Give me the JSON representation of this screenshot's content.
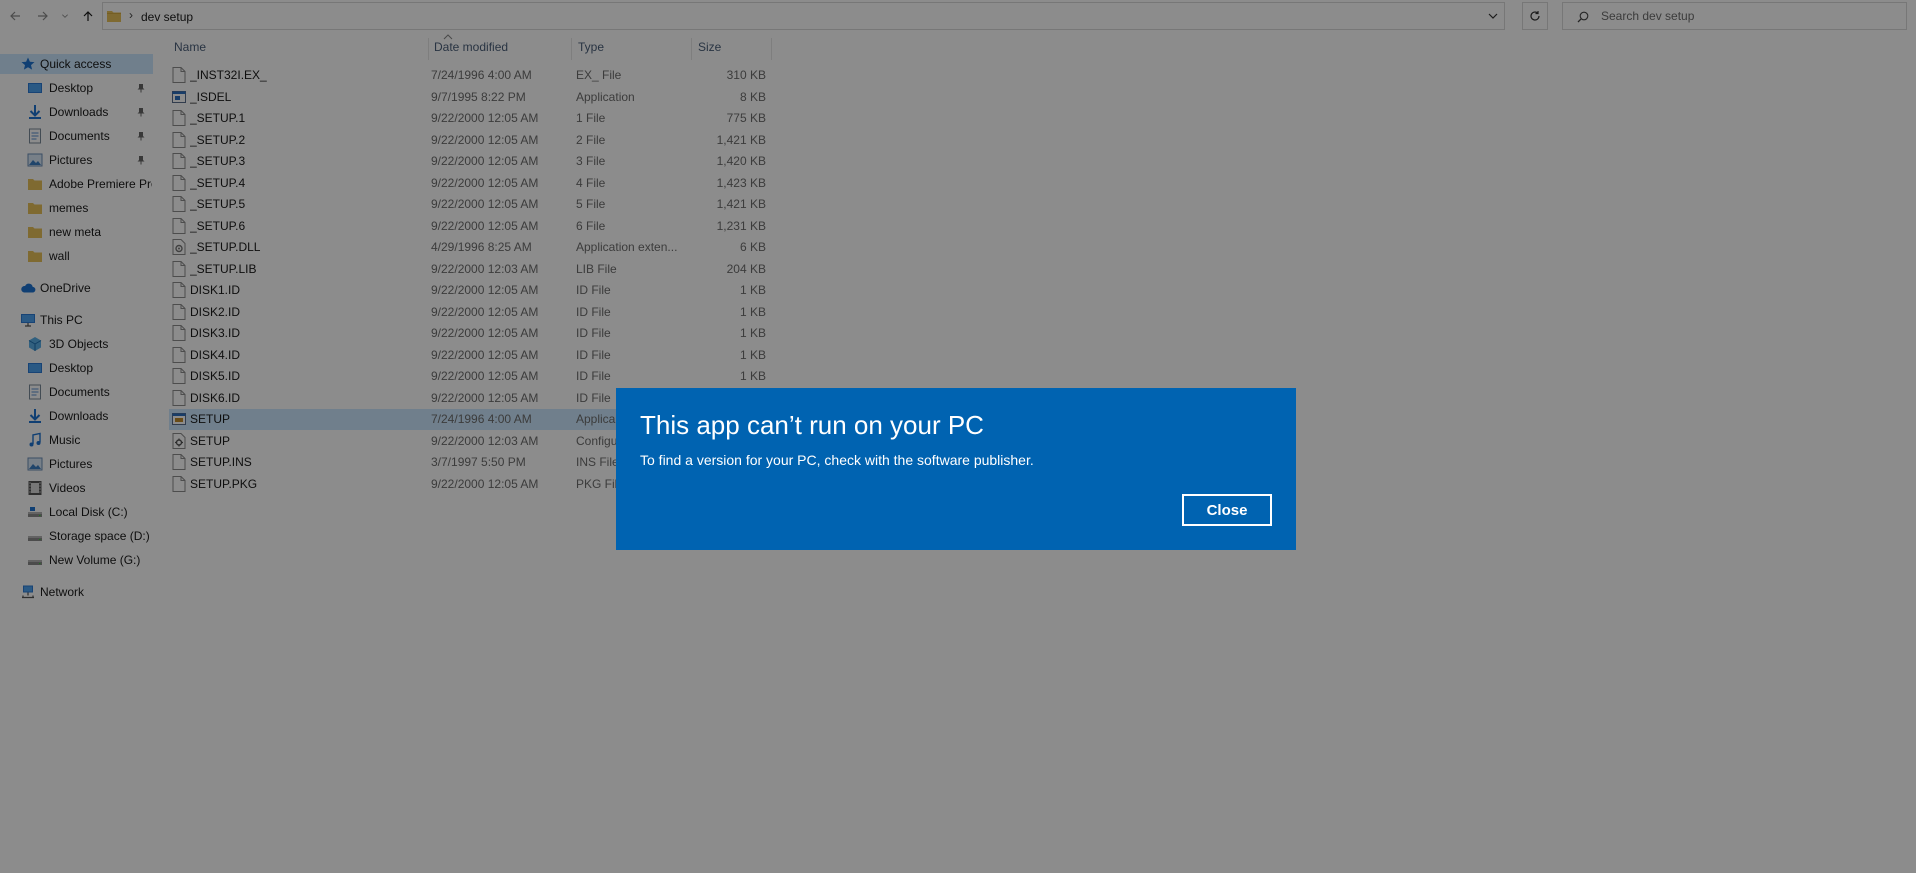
{
  "address_bar": {
    "path_segment": "dev setup",
    "separator": "›"
  },
  "search": {
    "placeholder": "Search dev setup"
  },
  "sidebar": {
    "quick_access": {
      "label": "Quick access",
      "items": [
        {
          "label": "Desktop",
          "icon": "desktop-icon",
          "pinned": true
        },
        {
          "label": "Downloads",
          "icon": "download-icon",
          "pinned": true
        },
        {
          "label": "Documents",
          "icon": "documents-icon",
          "pinned": true
        },
        {
          "label": "Pictures",
          "icon": "pictures-icon",
          "pinned": true
        },
        {
          "label": "Adobe Premiere Pro",
          "icon": "folder-icon",
          "pinned": false
        },
        {
          "label": "memes",
          "icon": "folder-icon",
          "pinned": false
        },
        {
          "label": "new meta",
          "icon": "folder-icon",
          "pinned": false
        },
        {
          "label": "wall",
          "icon": "folder-icon",
          "pinned": false
        }
      ]
    },
    "onedrive": {
      "label": "OneDrive"
    },
    "this_pc": {
      "label": "This PC",
      "items": [
        {
          "label": "3D Objects",
          "icon": "3d-objects-icon"
        },
        {
          "label": "Desktop",
          "icon": "desktop-icon"
        },
        {
          "label": "Documents",
          "icon": "documents-icon"
        },
        {
          "label": "Downloads",
          "icon": "download-icon"
        },
        {
          "label": "Music",
          "icon": "music-icon"
        },
        {
          "label": "Pictures",
          "icon": "pictures-icon"
        },
        {
          "label": "Videos",
          "icon": "videos-icon"
        },
        {
          "label": "Local Disk (C:)",
          "icon": "drive-icon"
        },
        {
          "label": "Storage space (D:)",
          "icon": "drive-icon"
        },
        {
          "label": "New Volume (G:)",
          "icon": "drive-icon"
        }
      ]
    },
    "network": {
      "label": "Network"
    }
  },
  "file_list": {
    "columns": {
      "name": "Name",
      "date": "Date modified",
      "type": "Type",
      "size": "Size"
    },
    "rows": [
      {
        "name": "_INST32I.EX_",
        "date": "7/24/1996 4:00 AM",
        "type": "EX_ File",
        "size": "310 KB",
        "icon": "file-icon"
      },
      {
        "name": "_ISDEL",
        "date": "9/7/1995 8:22 PM",
        "type": "Application",
        "size": "8 KB",
        "icon": "application-icon"
      },
      {
        "name": "_SETUP.1",
        "date": "9/22/2000 12:05 AM",
        "type": "1 File",
        "size": "775 KB",
        "icon": "file-icon"
      },
      {
        "name": "_SETUP.2",
        "date": "9/22/2000 12:05 AM",
        "type": "2 File",
        "size": "1,421 KB",
        "icon": "file-icon"
      },
      {
        "name": "_SETUP.3",
        "date": "9/22/2000 12:05 AM",
        "type": "3 File",
        "size": "1,420 KB",
        "icon": "file-icon"
      },
      {
        "name": "_SETUP.4",
        "date": "9/22/2000 12:05 AM",
        "type": "4 File",
        "size": "1,423 KB",
        "icon": "file-icon"
      },
      {
        "name": "_SETUP.5",
        "date": "9/22/2000 12:05 AM",
        "type": "5 File",
        "size": "1,421 KB",
        "icon": "file-icon"
      },
      {
        "name": "_SETUP.6",
        "date": "9/22/2000 12:05 AM",
        "type": "6 File",
        "size": "1,231 KB",
        "icon": "file-icon"
      },
      {
        "name": "_SETUP.DLL",
        "date": "4/29/1996 8:25 AM",
        "type": "Application exten...",
        "size": "6 KB",
        "icon": "dll-icon"
      },
      {
        "name": "_SETUP.LIB",
        "date": "9/22/2000 12:03 AM",
        "type": "LIB File",
        "size": "204 KB",
        "icon": "file-icon"
      },
      {
        "name": "DISK1.ID",
        "date": "9/22/2000 12:05 AM",
        "type": "ID File",
        "size": "1 KB",
        "icon": "file-icon"
      },
      {
        "name": "DISK2.ID",
        "date": "9/22/2000 12:05 AM",
        "type": "ID File",
        "size": "1 KB",
        "icon": "file-icon"
      },
      {
        "name": "DISK3.ID",
        "date": "9/22/2000 12:05 AM",
        "type": "ID File",
        "size": "1 KB",
        "icon": "file-icon"
      },
      {
        "name": "DISK4.ID",
        "date": "9/22/2000 12:05 AM",
        "type": "ID File",
        "size": "1 KB",
        "icon": "file-icon"
      },
      {
        "name": "DISK5.ID",
        "date": "9/22/2000 12:05 AM",
        "type": "ID File",
        "size": "1 KB",
        "icon": "file-icon"
      },
      {
        "name": "DISK6.ID",
        "date": "9/22/2000 12:05 AM",
        "type": "ID File",
        "size": "",
        "icon": "file-icon"
      },
      {
        "name": "SETUP",
        "date": "7/24/1996 4:00 AM",
        "type": "Applica",
        "size": "",
        "icon": "setup-app-icon",
        "selected": true
      },
      {
        "name": "SETUP",
        "date": "9/22/2000 12:03 AM",
        "type": "Configu",
        "size": "",
        "icon": "config-icon"
      },
      {
        "name": "SETUP.INS",
        "date": "3/7/1997 5:50 PM",
        "type": "INS File",
        "size": "",
        "icon": "file-icon"
      },
      {
        "name": "SETUP.PKG",
        "date": "9/22/2000 12:05 AM",
        "type": "PKG File",
        "size": "",
        "icon": "file-icon"
      }
    ]
  },
  "dialog": {
    "title": "This app can’t run on your PC",
    "message": "To find a version for your PC, check with the software publisher.",
    "close_label": "Close",
    "background": "#0063b1"
  },
  "colors": {
    "selection": "#cce8ff",
    "folder": "#e8c15a",
    "accent": "#0078d7"
  }
}
